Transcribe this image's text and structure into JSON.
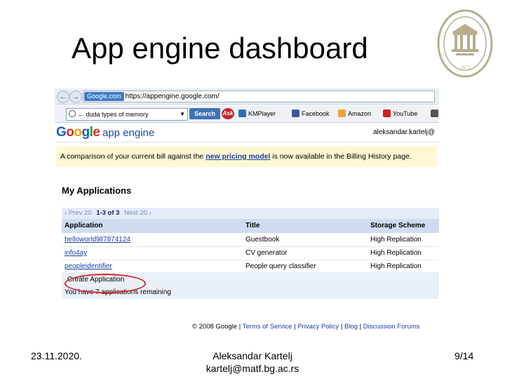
{
  "slide": {
    "title": "App engine dashboard",
    "date": "23.11.2020.",
    "author_name": "Aleksandar Kartelj",
    "author_email": "kartelj@matf.bg.ac.rs",
    "page": "9/14"
  },
  "seal": {
    "text_top": "МАТЕМАТИЧКИ ФАКУЛТЕТ",
    "text_bottom": "У БЕОГРАДУ",
    "year": "1873",
    "color": "#b7ad8f"
  },
  "browser": {
    "back_icon": "←",
    "forward_icon": "→",
    "address_tag": "Google.com",
    "address_url": "https://appengine.google.com/",
    "search_placeholder": "← duda types of memory",
    "search_button": "Search",
    "ask_label": "Ask",
    "toolbar_items": [
      {
        "name": "km-player",
        "label": "KMPlayer",
        "icon_color": "#2b6fb8"
      },
      {
        "name": "facebook",
        "label": "Facebook",
        "icon_color": "#3b5998"
      },
      {
        "name": "amazon",
        "label": "Amazon",
        "icon_color": "#f2a23a"
      },
      {
        "name": "youtube",
        "label": "YouTube",
        "icon_color": "#d21f1f"
      },
      {
        "name": "wikipedia",
        "label": "W",
        "icon_color": "#555555"
      }
    ]
  },
  "gae": {
    "logo_letters": [
      "G",
      "o",
      "o",
      "g",
      "l",
      "e"
    ],
    "product": "app engine",
    "user_email": "aleksandar.kartelj@",
    "notice_before": "A comparison of your current bill against the ",
    "notice_link": "new pricing model",
    "notice_after": " is now available in the Billing History page.",
    "section_title": "My Applications",
    "pager": {
      "prev": "‹ Prev 20",
      "count": "1-3 of 3",
      "next": "Next 20 ›"
    },
    "columns": [
      "Application",
      "Title",
      "Storage Scheme"
    ],
    "rows": [
      {
        "app": "helloworld9ll7874124",
        "title": "Guestbook",
        "storage": "High Replication"
      },
      {
        "app": "info4ay",
        "title": "CV generator",
        "storage": "High Replication"
      },
      {
        "app": "peopleidentifier",
        "title": "People query classifier",
        "storage": "High Replication"
      }
    ],
    "create_button": "Create Application",
    "remaining": "You have 7 applications remaining",
    "footer": {
      "copyright": "© 2008 Google",
      "links": [
        "Terms of Service",
        "Privacy Policy",
        "Blog",
        "Discussion Forums"
      ]
    },
    "highlight_color": "#d7262a"
  }
}
